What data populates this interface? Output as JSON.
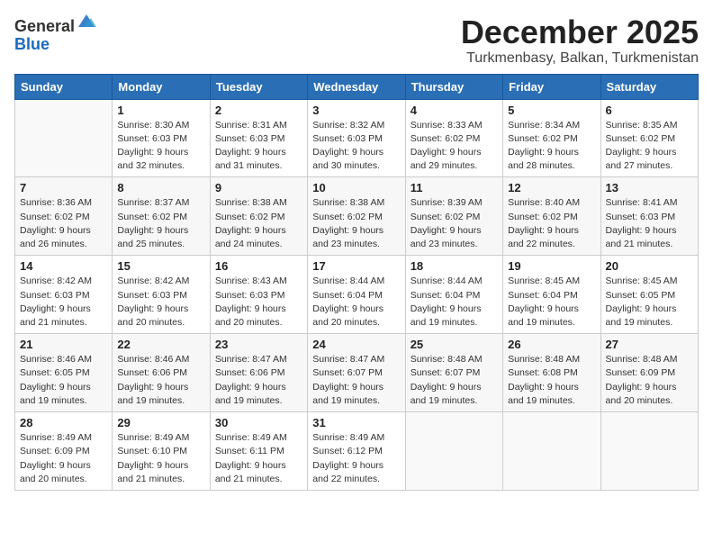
{
  "header": {
    "logo_general": "General",
    "logo_blue": "Blue",
    "title": "December 2025",
    "location": "Turkmenbasy, Balkan, Turkmenistan"
  },
  "weekdays": [
    "Sunday",
    "Monday",
    "Tuesday",
    "Wednesday",
    "Thursday",
    "Friday",
    "Saturday"
  ],
  "weeks": [
    [
      {
        "day": "",
        "sunrise": "",
        "sunset": "",
        "daylight": ""
      },
      {
        "day": "1",
        "sunrise": "Sunrise: 8:30 AM",
        "sunset": "Sunset: 6:03 PM",
        "daylight": "Daylight: 9 hours and 32 minutes."
      },
      {
        "day": "2",
        "sunrise": "Sunrise: 8:31 AM",
        "sunset": "Sunset: 6:03 PM",
        "daylight": "Daylight: 9 hours and 31 minutes."
      },
      {
        "day": "3",
        "sunrise": "Sunrise: 8:32 AM",
        "sunset": "Sunset: 6:03 PM",
        "daylight": "Daylight: 9 hours and 30 minutes."
      },
      {
        "day": "4",
        "sunrise": "Sunrise: 8:33 AM",
        "sunset": "Sunset: 6:02 PM",
        "daylight": "Daylight: 9 hours and 29 minutes."
      },
      {
        "day": "5",
        "sunrise": "Sunrise: 8:34 AM",
        "sunset": "Sunset: 6:02 PM",
        "daylight": "Daylight: 9 hours and 28 minutes."
      },
      {
        "day": "6",
        "sunrise": "Sunrise: 8:35 AM",
        "sunset": "Sunset: 6:02 PM",
        "daylight": "Daylight: 9 hours and 27 minutes."
      }
    ],
    [
      {
        "day": "7",
        "sunrise": "Sunrise: 8:36 AM",
        "sunset": "Sunset: 6:02 PM",
        "daylight": "Daylight: 9 hours and 26 minutes."
      },
      {
        "day": "8",
        "sunrise": "Sunrise: 8:37 AM",
        "sunset": "Sunset: 6:02 PM",
        "daylight": "Daylight: 9 hours and 25 minutes."
      },
      {
        "day": "9",
        "sunrise": "Sunrise: 8:38 AM",
        "sunset": "Sunset: 6:02 PM",
        "daylight": "Daylight: 9 hours and 24 minutes."
      },
      {
        "day": "10",
        "sunrise": "Sunrise: 8:38 AM",
        "sunset": "Sunset: 6:02 PM",
        "daylight": "Daylight: 9 hours and 23 minutes."
      },
      {
        "day": "11",
        "sunrise": "Sunrise: 8:39 AM",
        "sunset": "Sunset: 6:02 PM",
        "daylight": "Daylight: 9 hours and 23 minutes."
      },
      {
        "day": "12",
        "sunrise": "Sunrise: 8:40 AM",
        "sunset": "Sunset: 6:02 PM",
        "daylight": "Daylight: 9 hours and 22 minutes."
      },
      {
        "day": "13",
        "sunrise": "Sunrise: 8:41 AM",
        "sunset": "Sunset: 6:03 PM",
        "daylight": "Daylight: 9 hours and 21 minutes."
      }
    ],
    [
      {
        "day": "14",
        "sunrise": "Sunrise: 8:42 AM",
        "sunset": "Sunset: 6:03 PM",
        "daylight": "Daylight: 9 hours and 21 minutes."
      },
      {
        "day": "15",
        "sunrise": "Sunrise: 8:42 AM",
        "sunset": "Sunset: 6:03 PM",
        "daylight": "Daylight: 9 hours and 20 minutes."
      },
      {
        "day": "16",
        "sunrise": "Sunrise: 8:43 AM",
        "sunset": "Sunset: 6:03 PM",
        "daylight": "Daylight: 9 hours and 20 minutes."
      },
      {
        "day": "17",
        "sunrise": "Sunrise: 8:44 AM",
        "sunset": "Sunset: 6:04 PM",
        "daylight": "Daylight: 9 hours and 20 minutes."
      },
      {
        "day": "18",
        "sunrise": "Sunrise: 8:44 AM",
        "sunset": "Sunset: 6:04 PM",
        "daylight": "Daylight: 9 hours and 19 minutes."
      },
      {
        "day": "19",
        "sunrise": "Sunrise: 8:45 AM",
        "sunset": "Sunset: 6:04 PM",
        "daylight": "Daylight: 9 hours and 19 minutes."
      },
      {
        "day": "20",
        "sunrise": "Sunrise: 8:45 AM",
        "sunset": "Sunset: 6:05 PM",
        "daylight": "Daylight: 9 hours and 19 minutes."
      }
    ],
    [
      {
        "day": "21",
        "sunrise": "Sunrise: 8:46 AM",
        "sunset": "Sunset: 6:05 PM",
        "daylight": "Daylight: 9 hours and 19 minutes."
      },
      {
        "day": "22",
        "sunrise": "Sunrise: 8:46 AM",
        "sunset": "Sunset: 6:06 PM",
        "daylight": "Daylight: 9 hours and 19 minutes."
      },
      {
        "day": "23",
        "sunrise": "Sunrise: 8:47 AM",
        "sunset": "Sunset: 6:06 PM",
        "daylight": "Daylight: 9 hours and 19 minutes."
      },
      {
        "day": "24",
        "sunrise": "Sunrise: 8:47 AM",
        "sunset": "Sunset: 6:07 PM",
        "daylight": "Daylight: 9 hours and 19 minutes."
      },
      {
        "day": "25",
        "sunrise": "Sunrise: 8:48 AM",
        "sunset": "Sunset: 6:07 PM",
        "daylight": "Daylight: 9 hours and 19 minutes."
      },
      {
        "day": "26",
        "sunrise": "Sunrise: 8:48 AM",
        "sunset": "Sunset: 6:08 PM",
        "daylight": "Daylight: 9 hours and 19 minutes."
      },
      {
        "day": "27",
        "sunrise": "Sunrise: 8:48 AM",
        "sunset": "Sunset: 6:09 PM",
        "daylight": "Daylight: 9 hours and 20 minutes."
      }
    ],
    [
      {
        "day": "28",
        "sunrise": "Sunrise: 8:49 AM",
        "sunset": "Sunset: 6:09 PM",
        "daylight": "Daylight: 9 hours and 20 minutes."
      },
      {
        "day": "29",
        "sunrise": "Sunrise: 8:49 AM",
        "sunset": "Sunset: 6:10 PM",
        "daylight": "Daylight: 9 hours and 21 minutes."
      },
      {
        "day": "30",
        "sunrise": "Sunrise: 8:49 AM",
        "sunset": "Sunset: 6:11 PM",
        "daylight": "Daylight: 9 hours and 21 minutes."
      },
      {
        "day": "31",
        "sunrise": "Sunrise: 8:49 AM",
        "sunset": "Sunset: 6:12 PM",
        "daylight": "Daylight: 9 hours and 22 minutes."
      },
      {
        "day": "",
        "sunrise": "",
        "sunset": "",
        "daylight": ""
      },
      {
        "day": "",
        "sunrise": "",
        "sunset": "",
        "daylight": ""
      },
      {
        "day": "",
        "sunrise": "",
        "sunset": "",
        "daylight": ""
      }
    ]
  ]
}
